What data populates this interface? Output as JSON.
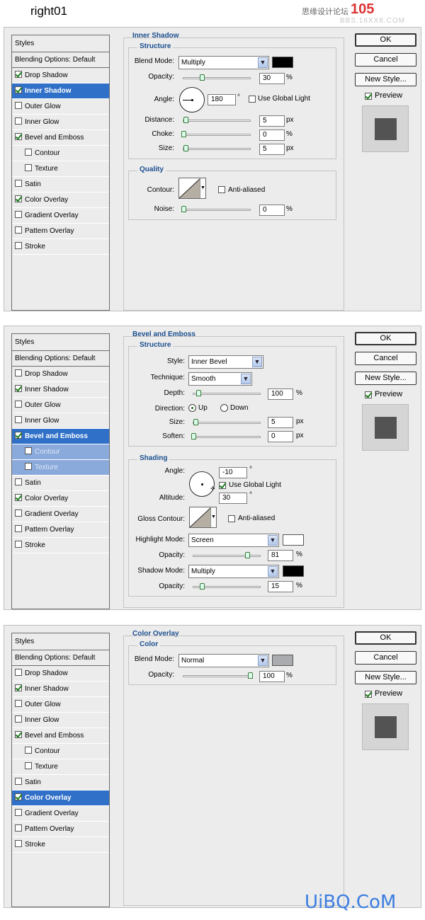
{
  "header": {
    "title": "right01",
    "watermark_site": "思缘设计论坛",
    "watermark_number": "105",
    "watermark_url": "BBS.16XX8.COM"
  },
  "footer": {
    "logo": "UiBQ.CoM"
  },
  "common": {
    "ok": "OK",
    "cancel": "Cancel",
    "new_style": "New Style...",
    "preview": "Preview",
    "styles": "Styles",
    "blending": "Blending Options: Default",
    "px": "px",
    "pct": "%",
    "deg": "°"
  },
  "style_items": [
    "Drop Shadow",
    "Inner Shadow",
    "Outer Glow",
    "Inner Glow",
    "Bevel and Emboss",
    "Contour",
    "Texture",
    "Satin",
    "Color Overlay",
    "Gradient Overlay",
    "Pattern Overlay",
    "Stroke"
  ],
  "panel1": {
    "title": "Inner Shadow",
    "structure": "Structure",
    "quality": "Quality",
    "blend_mode_label": "Blend Mode:",
    "blend_mode": "Multiply",
    "blend_color": "#000000",
    "opacity_label": "Opacity:",
    "opacity": "30",
    "angle_label": "Angle:",
    "angle": "180",
    "use_global": "Use Global Light",
    "distance_label": "Distance:",
    "distance": "5",
    "choke_label": "Choke:",
    "choke": "0",
    "size_label": "Size:",
    "size": "5",
    "contour_label": "Contour:",
    "anti": "Anti-aliased",
    "noise_label": "Noise:",
    "noise": "0"
  },
  "panel2": {
    "title": "Bevel and Emboss",
    "structure": "Structure",
    "shading": "Shading",
    "style_label": "Style:",
    "style": "Inner Bevel",
    "technique_label": "Technique:",
    "technique": "Smooth",
    "depth_label": "Depth:",
    "depth": "100",
    "direction_label": "Direction:",
    "up": "Up",
    "down": "Down",
    "size_label": "Size:",
    "size": "5",
    "soften_label": "Soften:",
    "soften": "0",
    "angle_label": "Angle:",
    "angle": "-10",
    "use_global": "Use Global Light",
    "altitude_label": "Altitude:",
    "altitude": "30",
    "gloss_label": "Gloss Contour:",
    "anti": "Anti-aliased",
    "hl_mode_label": "Highlight Mode:",
    "hl_mode": "Screen",
    "hl_color": "#ffffff",
    "hl_opacity_label": "Opacity:",
    "hl_opacity": "81",
    "sh_mode_label": "Shadow Mode:",
    "sh_mode": "Multiply",
    "sh_color": "#000000",
    "sh_opacity_label": "Opacity:",
    "sh_opacity": "15"
  },
  "panel3": {
    "title": "Color Overlay",
    "color": "Color",
    "blend_mode_label": "Blend Mode:",
    "blend_mode": "Normal",
    "blend_color": "#a9abae",
    "opacity_label": "Opacity:",
    "opacity": "100"
  },
  "colors": {
    "selection": "#3070c8",
    "title_blue": "#1c4f8f",
    "preview_square": "#535353"
  }
}
